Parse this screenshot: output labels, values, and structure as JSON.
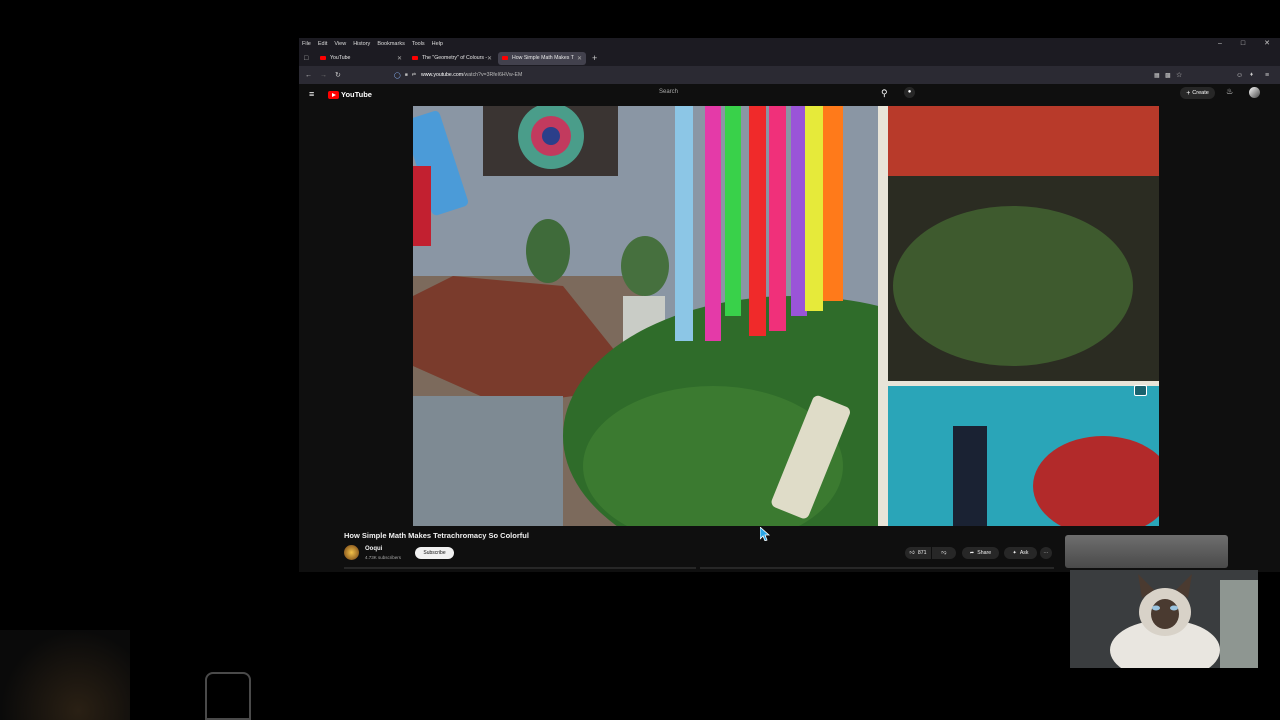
{
  "menu": [
    "File",
    "Edit",
    "View",
    "History",
    "Bookmarks",
    "Tools",
    "Help"
  ],
  "tabs": [
    {
      "label": "YouTube",
      "active": false
    },
    {
      "label": "The \"Geometry\" of Colours - Yo",
      "active": false
    },
    {
      "label": "How Simple Math Makes T",
      "active": true
    }
  ],
  "url": {
    "host": "www.youtube.com",
    "path": "/watch?v=3RfeI6HVw-EM"
  },
  "youtube": {
    "logo_text": "YouTube",
    "search_placeholder": "Search",
    "create_label": "Create"
  },
  "video": {
    "title": "How Simple Math Makes Tetrachromacy So Colorful",
    "channel": "Ooqui",
    "subscribers": "4.73K subscribers",
    "subscribe_label": "Subscribe",
    "likes": "871",
    "share_label": "Share",
    "ask_label": "Ask"
  },
  "colors": {
    "youtube_red": "#ff0000",
    "page_bg": "#0f0f0f",
    "tab_active": "#42414d"
  },
  "icons": [
    "hamburger-menu-icon",
    "search-icon",
    "microphone-icon",
    "bell-icon",
    "like-icon",
    "dislike-icon",
    "share-icon",
    "sparkle-icon",
    "more-icon"
  ]
}
